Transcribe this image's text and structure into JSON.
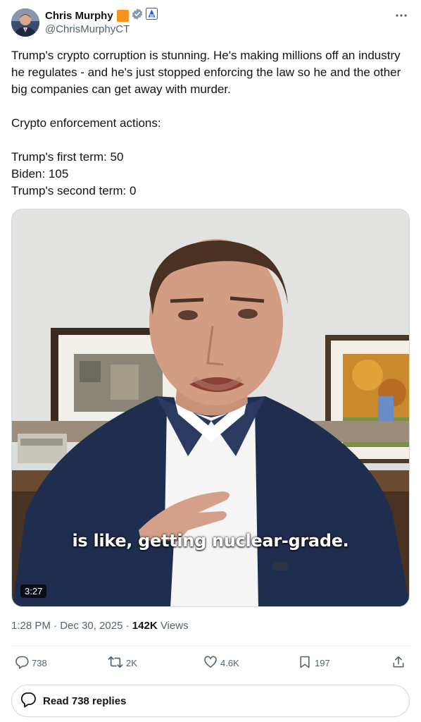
{
  "author": {
    "display_name": "Chris Murphy",
    "handle": "@ChrisMurphyCT"
  },
  "post": {
    "paragraph_1": "Trump's crypto corruption is stunning. He's making millions off an industry he regulates - and he's just stopped enforcing the law so he and the other big companies can get away with murder.",
    "paragraph_2": "Crypto enforcement actions:",
    "line_first_term": "Trump's first term: 50",
    "line_biden": "Biden: 105",
    "line_second_term": "Trump's second term: 0"
  },
  "video": {
    "caption": "is like, getting nuclear-grade.",
    "duration": "3:27"
  },
  "meta": {
    "time": "1:28 PM",
    "separator_1": " · ",
    "date": "Dec 30, 2025",
    "separator_2": " · ",
    "views_count": "142K",
    "views_label": " Views"
  },
  "actions": {
    "replies": "738",
    "reposts": "2K",
    "likes": "4.6K",
    "bookmarks": "197"
  },
  "read_replies": {
    "label": "Read 738 replies"
  },
  "colors": {
    "accent": "#1d9bf0",
    "badge_orange": "#f7931a",
    "badge_blue": "#1d9bf0",
    "text_primary": "#0f1419",
    "text_secondary": "#536471"
  },
  "icons": {
    "verified": "verified-badge-icon",
    "affiliate": "affiliate-badge-icon",
    "more": "more-icon",
    "reply": "reply-icon",
    "repost": "repost-icon",
    "like": "like-icon",
    "bookmark": "bookmark-icon",
    "share": "share-icon",
    "replies_bubble": "replies-icon"
  }
}
